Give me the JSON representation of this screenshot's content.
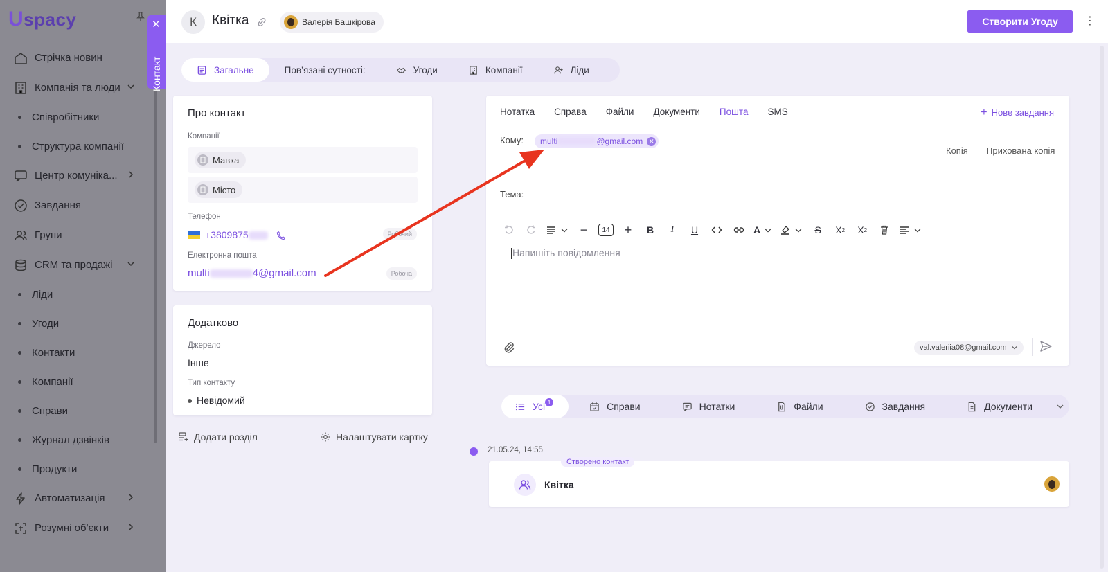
{
  "app": {
    "logo_u": "U",
    "logo_text": "spacy"
  },
  "sidebar": {
    "items": [
      {
        "type": "item",
        "label": "Стрічка новин",
        "icon": "home-icon"
      },
      {
        "type": "item",
        "label": "Компанія та люди",
        "icon": "building-icon",
        "chevron": "down"
      },
      {
        "type": "sub",
        "label": "Співробітники"
      },
      {
        "type": "sub",
        "label": "Структура компанії"
      },
      {
        "type": "item",
        "label": "Центр комуніка...",
        "icon": "chat-icon",
        "chevron": "right"
      },
      {
        "type": "item",
        "label": "Завдання",
        "icon": "check-circle-icon"
      },
      {
        "type": "item",
        "label": "Групи",
        "icon": "users-icon"
      },
      {
        "type": "item",
        "label": "CRM та продажі",
        "icon": "database-icon",
        "chevron": "down"
      },
      {
        "type": "sub",
        "label": "Ліди"
      },
      {
        "type": "sub",
        "label": "Угоди"
      },
      {
        "type": "sub",
        "label": "Контакти"
      },
      {
        "type": "sub",
        "label": "Компанії"
      },
      {
        "type": "sub",
        "label": "Справи"
      },
      {
        "type": "sub",
        "label": "Журнал дзвінків"
      },
      {
        "type": "sub",
        "label": "Продукти"
      },
      {
        "type": "item",
        "label": "Автоматизація",
        "icon": "bolt-icon",
        "chevron": "right"
      },
      {
        "type": "item",
        "label": "Розумні об'єкти",
        "icon": "smart-object-icon",
        "chevron": "right"
      }
    ]
  },
  "contact_tab": {
    "label": "Контакт",
    "close": "✕"
  },
  "header": {
    "avatar_letter": "К",
    "title": "Квітка",
    "owner": "Валерія Башкірова",
    "create_button": "Створити Угоду",
    "more": "⋮"
  },
  "tabs": {
    "general": "Загальне",
    "related_label": "Пов’язані сутності:",
    "deals": "Угоди",
    "companies": "Компанії",
    "leads": "Ліди"
  },
  "about": {
    "title": "Про контакт",
    "companies_label": "Компанії",
    "companies": [
      "Мавка",
      "Місто"
    ],
    "phone_label": "Телефон",
    "phone_prefix": "+3809875",
    "phone_tag": "Робочий",
    "email_label": "Електронна пошта",
    "email_prefix": "multi",
    "email_suffix": "4@gmail.com",
    "email_tag": "Робоча"
  },
  "extra": {
    "title": "Додатково",
    "source_label": "Джерело",
    "source_value": "Інше",
    "type_label": "Тип контакту",
    "type_value": "Невідомий"
  },
  "footer_links": {
    "add_section": "Додати розділ",
    "configure": "Налаштувати картку"
  },
  "composer": {
    "tabs": [
      "Нотатка",
      "Справа",
      "Файли",
      "Документи",
      "Пошта",
      "SMS"
    ],
    "active_tab": "Пошта",
    "new_task": "Нове завдання",
    "to_label": "Кому:",
    "recipient_prefix": "multi",
    "recipient_suffix": "@gmail.com",
    "copy": "Копія",
    "hidden_copy": "Прихована копія",
    "subject_label": "Тема:",
    "font_size": "14",
    "placeholder": "Напишіть повідомлення",
    "from": "val.valeriia08@gmail.com"
  },
  "timeline": {
    "tabs": [
      "Усі",
      "Справи",
      "Нотатки",
      "Файли",
      "Завдання",
      "Документи"
    ],
    "all_count": "1",
    "date": "21.05.24, 14:55",
    "event_tag": "Створено контакт",
    "event_name": "Квітка"
  },
  "colors": {
    "accent": "#8b5cf0",
    "accent_text": "#7b4fe0",
    "sidebar_overlay": "#8b8a92",
    "annotation_arrow": "#e8341f"
  }
}
